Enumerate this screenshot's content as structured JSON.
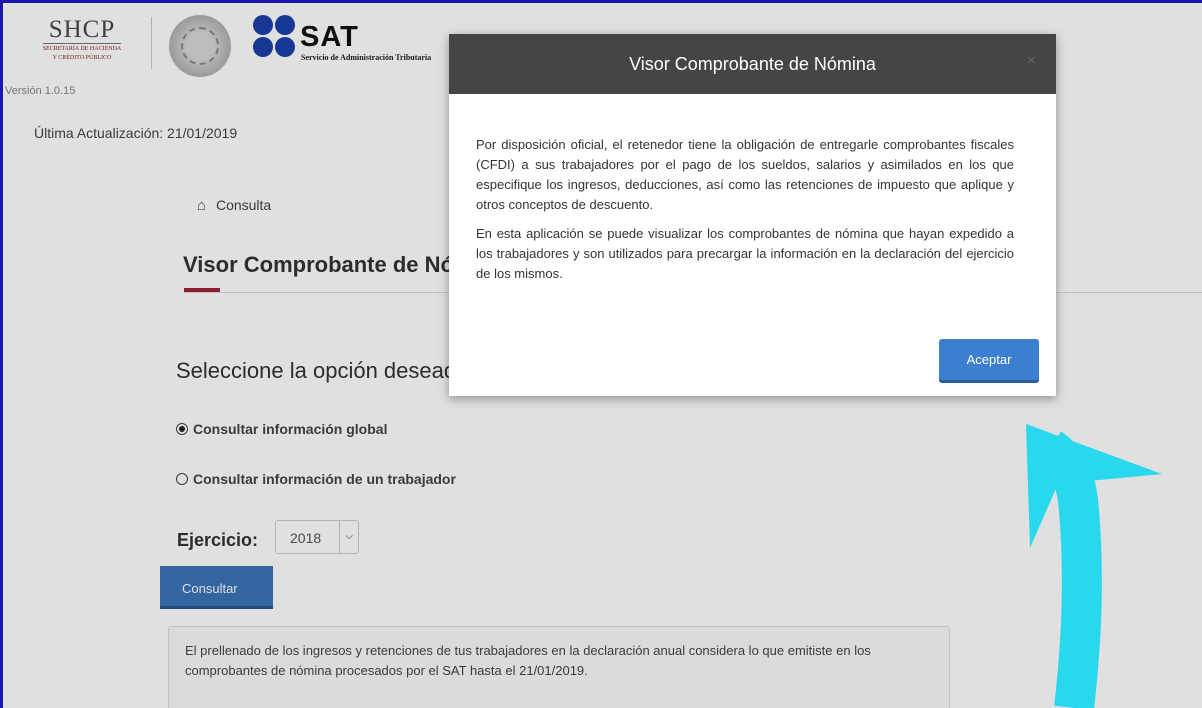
{
  "header": {
    "shcp_logo": "SHCP",
    "shcp_subtitle_1": "SECRETARÍA DE HACIENDA",
    "shcp_subtitle_2": "Y CRÉDITO PÚBLICO",
    "sat_logo": "SAT",
    "sat_subtitle": "Servicio de Administración Tributaria",
    "version": "Versión 1.0.15",
    "last_update": "Última Actualización: 21/01/2019"
  },
  "breadcrumb": {
    "home_icon": "home-icon",
    "label": "Consulta"
  },
  "page": {
    "title": "Visor Comprobante de Nómina",
    "select_heading": "Seleccione la opción deseada",
    "radio_options": [
      {
        "label": "Consultar información global",
        "checked": true
      },
      {
        "label": "Consultar información de un trabajador",
        "checked": false
      }
    ],
    "ejercicio_label": "Ejercicio:",
    "year_value": "2018",
    "consultar_button": "Consultar",
    "info_text": "El prellenado de los ingresos y retenciones de tus trabajadores en la declaración anual considera lo que emitiste en los comprobantes de nómina procesados por el SAT hasta el 21/01/2019."
  },
  "modal": {
    "title": "Visor Comprobante de Nómina",
    "close_icon": "close-icon",
    "paragraph_1": "Por disposición oficial, el retenedor tiene la obligación de entregarle comprobantes fiscales (CFDI) a sus trabajadores por el pago de los sueldos, salarios y asimilados en los que especifique los ingresos, deducciones, así como las retenciones de impuesto que aplique y otros conceptos de descuento.",
    "paragraph_2": "En esta aplicación se puede visualizar los comprobantes de nómina que hayan expedido a los trabajadores y son utilizados para precargar la información en la declaración del ejercicio de los mismos.",
    "accept_button": "Aceptar"
  },
  "colors": {
    "frame_border": "#1a1aa8",
    "accent_red": "#9b2335",
    "primary_button": "#3b73b7",
    "modal_header": "#454545",
    "annotation_arrow": "#2ad8ee"
  }
}
